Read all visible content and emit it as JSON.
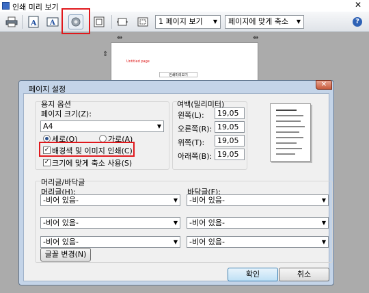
{
  "window": {
    "title": "인쇄 미리 보기",
    "close_glyph": "✕"
  },
  "toolbar": {
    "view_combo": "1 페이지 보기",
    "zoom_combo": "페이지에 맞게 축소",
    "help_glyph": "?",
    "combo_arrow": "▼"
  },
  "preview": {
    "header_text": "Untitled page",
    "footer_text": "인쇄미리보기"
  },
  "dialog": {
    "title": "페이지 설정",
    "close_glyph": "✕",
    "paper": {
      "group_label": "용지 옵션",
      "size_label": "페이지 크기(Z):",
      "size_value": "A4",
      "portrait_label": "세로(O)",
      "landscape_label": "가로(A)",
      "portrait_selected": true,
      "print_bg_label": "배경색 및 이미지 인쇄(C)",
      "print_bg_checked": true,
      "shrink_label": "크기에 맞게 축소 사용(S)",
      "shrink_checked": true,
      "check_glyph": "✓"
    },
    "margins": {
      "group_label": "여백(밀리미터)",
      "left_label": "왼쪽(L):",
      "left_value": "19,05",
      "right_label": "오른쪽(R):",
      "right_value": "19,05",
      "top_label": "위쪽(T):",
      "top_value": "19,05",
      "bottom_label": "아래쪽(B):",
      "bottom_value": "19,05"
    },
    "headers_footers": {
      "group_label": "머리글/바닥글",
      "header_label": "머리글(H):",
      "footer_label": "바닥글(F):",
      "header_values": [
        "-비어 있음-",
        "-비어 있음-",
        "-비어 있음-"
      ],
      "footer_values": [
        "-비어 있음-",
        "-비어 있음-",
        "-비어 있음-"
      ],
      "font_button": "글꼴 변경(N)"
    },
    "ok_button": "확인",
    "cancel_button": "취소"
  }
}
